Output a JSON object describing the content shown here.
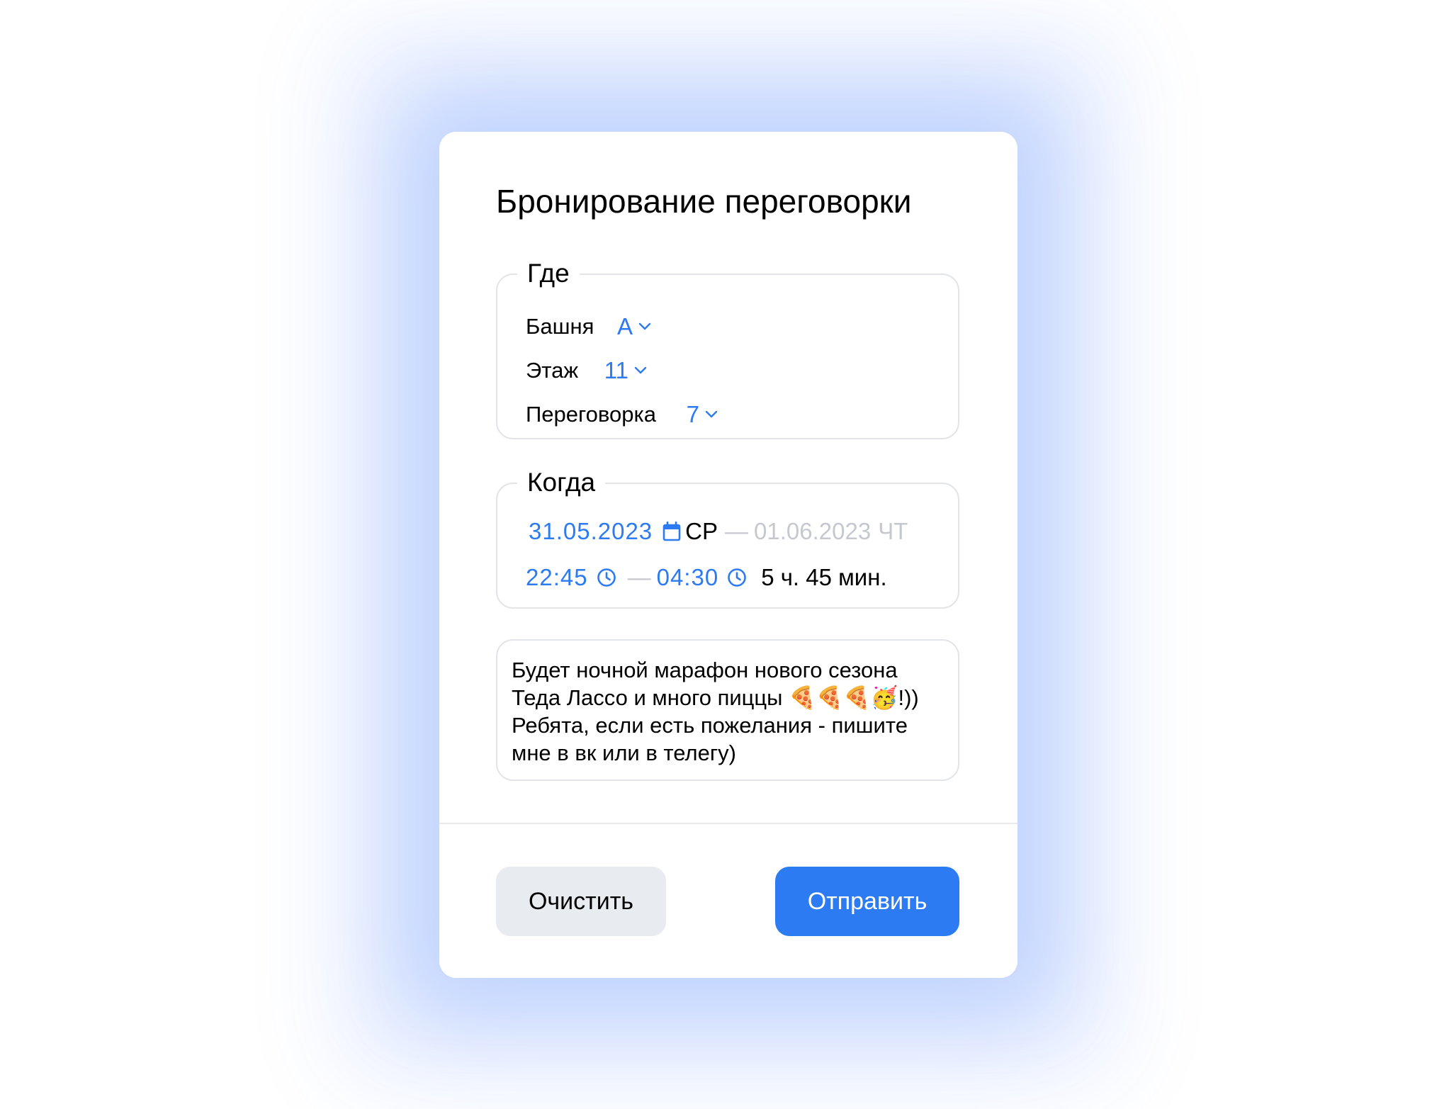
{
  "dialog": {
    "title": "Бронирование переговорки"
  },
  "where": {
    "legend": "Где",
    "tower": {
      "label": "Башня",
      "value": "А"
    },
    "floor": {
      "label": "Этаж",
      "value": "11"
    },
    "room": {
      "label": "Переговорка",
      "value": "7"
    }
  },
  "when": {
    "legend": "Когда",
    "start_date": "31.05.2023",
    "start_weekday": "СР",
    "date_separator": "—",
    "end_date": "01.06.2023",
    "end_weekday": "ЧТ",
    "start_time": "22:45",
    "time_separator": "—",
    "end_time": "04:30",
    "duration": "5 ч. 45 мин."
  },
  "comment": {
    "text": "Будет ночной марафон нового сезона\nТеда Лассо и много пиццы 🍕🍕🍕🥳!))\nРебята, если есть пожелания - пишите\nмне в вк или в телегу)"
  },
  "actions": {
    "clear_label": "Очистить",
    "submit_label": "Отправить"
  },
  "icons": {
    "dropdown": "chevron-down-icon",
    "date": "calendar-icon",
    "time": "clock-icon"
  },
  "colors": {
    "accent": "#2c7bf2",
    "muted": "#c5c9cf",
    "border": "#e2e4e8",
    "secondary_button": "#e8ebf0",
    "glow": "#3a76fa"
  }
}
